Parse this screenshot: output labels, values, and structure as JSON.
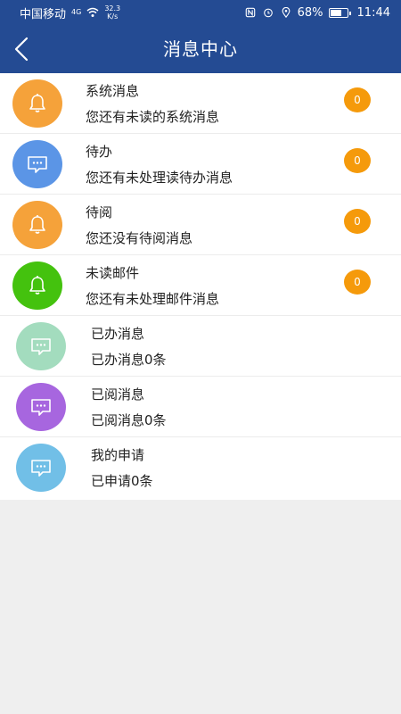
{
  "statusbar": {
    "carrier": "中国移动",
    "network": "4G",
    "speed_value": "32.3",
    "speed_unit": "K/s",
    "battery": "68%",
    "battery_level": 0.68,
    "time": "11:44"
  },
  "header": {
    "title": "消息中心"
  },
  "colors": {
    "header_bg": "#244b93",
    "badge": "#f59a0b",
    "orange": "#f5a23a",
    "blue": "#5b95e6",
    "green": "#44c20e",
    "mint": "#a3dcbe",
    "purple": "#a766df",
    "lightblue": "#71bfe7"
  },
  "items": [
    {
      "title": "系统消息",
      "desc": "您还有未读的系统消息",
      "badge": "0",
      "icon": "bell-icon",
      "color": "#f5a23a"
    },
    {
      "title": "待办",
      "desc": "您还有未处理读待办消息",
      "badge": "0",
      "icon": "chat-icon",
      "color": "#5b95e6"
    },
    {
      "title": "待阅",
      "desc": "您还没有待阅消息",
      "badge": "0",
      "icon": "bell-icon",
      "color": "#f5a23a"
    },
    {
      "title": "未读邮件",
      "desc": "您还有未处理邮件消息",
      "badge": "0",
      "icon": "bell-icon",
      "color": "#44c20e"
    },
    {
      "title": "已办消息",
      "desc": "已办消息0条",
      "icon": "chat-icon",
      "color": "#a3dcbe"
    },
    {
      "title": "已阅消息",
      "desc": "已阅消息0条",
      "icon": "chat-icon",
      "color": "#a766df"
    },
    {
      "title": "我的申请",
      "desc": "已申请0条",
      "icon": "chat-icon",
      "color": "#71bfe7"
    }
  ]
}
